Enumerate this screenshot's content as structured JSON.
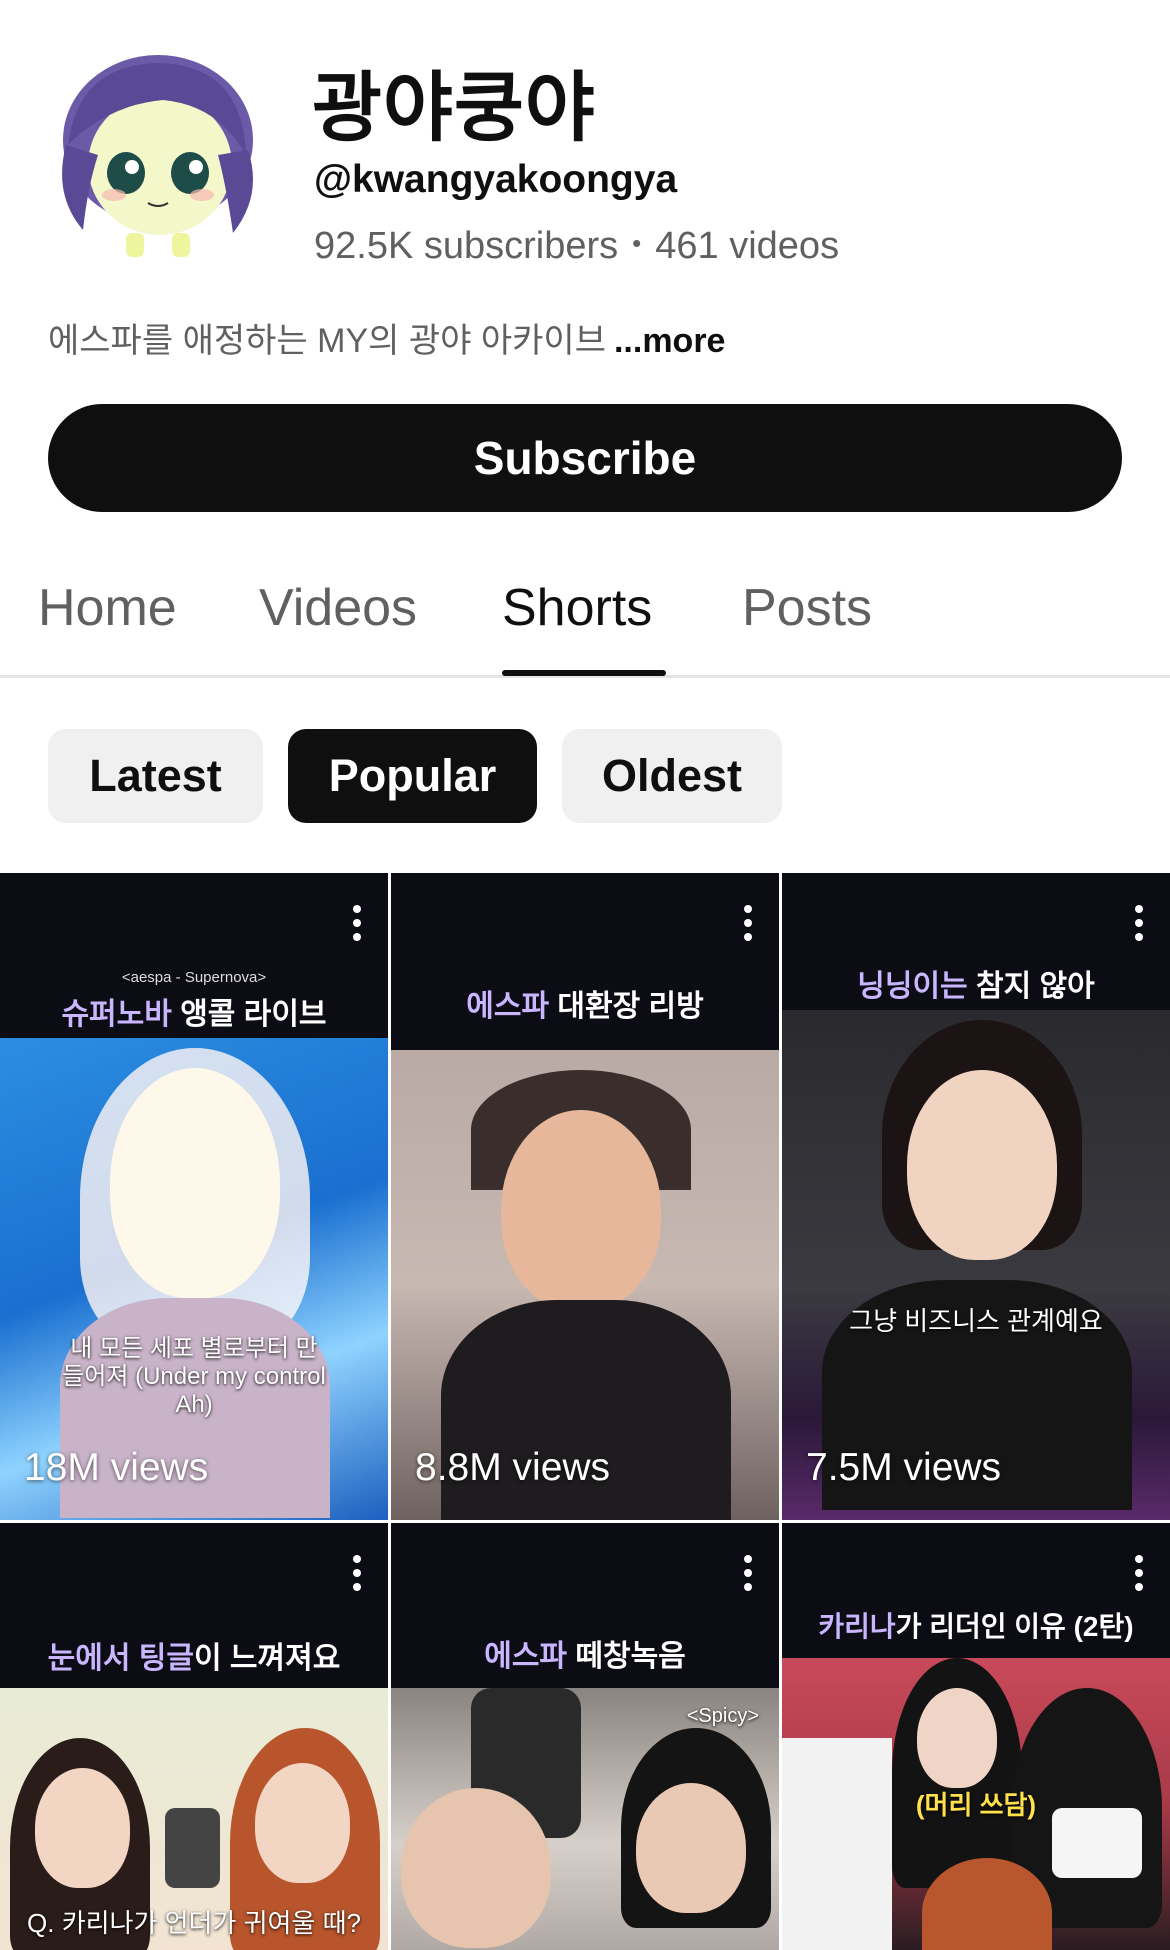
{
  "channel": {
    "name": "광야쿵야",
    "handle": "@kwangyakoongya",
    "subscribers": "92.5K subscribers",
    "separator": "•",
    "videos": "461 videos",
    "description": "에스파를 애정하는 MY의 광야 아카이브",
    "more_label": "...more"
  },
  "subscribe_label": "Subscribe",
  "tabs": [
    {
      "label": "Home"
    },
    {
      "label": "Videos"
    },
    {
      "label": "Shorts",
      "active": true
    },
    {
      "label": "Posts"
    }
  ],
  "chips": [
    {
      "label": "Latest"
    },
    {
      "label": "Popular",
      "active": true
    },
    {
      "label": "Oldest"
    }
  ],
  "shorts": [
    {
      "subtitle": "<aespa - Supernova>",
      "caption_hl": "슈퍼노바",
      "caption": " 앵콜 라이브",
      "overlay": "내 모든 세포 별로부터 만들어져 (Under my control Ah)",
      "views": "18M views"
    },
    {
      "caption_hl": "에스파",
      "caption": " 대환장 리방",
      "views": "8.8M views"
    },
    {
      "caption_hl": "닝닝이는",
      "caption": " 참지 않아",
      "overlay": "그냥 비즈니스 관계예요",
      "views": "7.5M views"
    },
    {
      "caption_hl": "눈에서 팅글",
      "caption": "이 느껴져요",
      "overlay": "Q. 카리나가 언더가 귀여울 때?"
    },
    {
      "caption_hl": "에스파",
      "caption": " 떼창녹음",
      "overlay": "<Spicy>"
    },
    {
      "caption_hl": "카리나",
      "caption": "가 리더인 이유 (2탄)",
      "overlay": "(머리 쓰담)"
    }
  ],
  "colors": {
    "accent_dark": "#0f0f0f",
    "muted_text": "#606060",
    "chip_bg": "#f0f0f0",
    "caption_highlight": "#c9b6ff"
  }
}
